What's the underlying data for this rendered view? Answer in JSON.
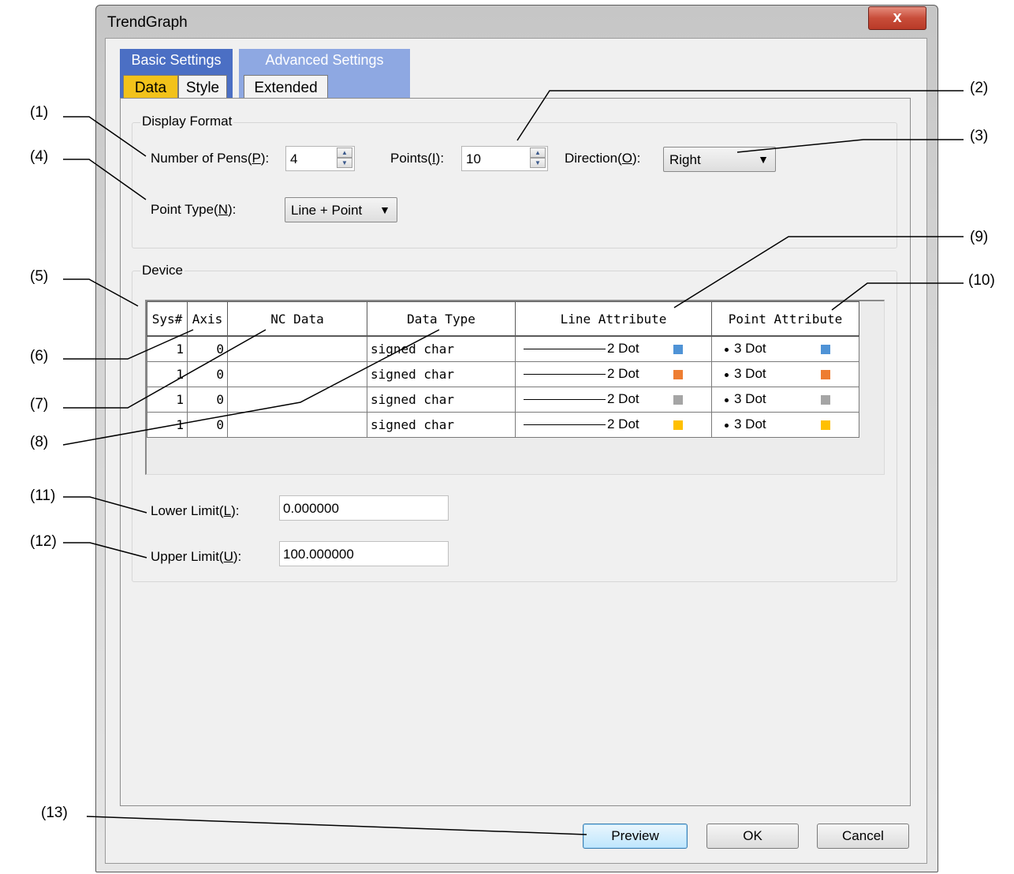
{
  "window": {
    "title": "TrendGraph",
    "close_glyph": "x"
  },
  "tabs": {
    "basic": {
      "title": "Basic Settings",
      "subtabs": [
        "Data",
        "Style"
      ]
    },
    "advanced": {
      "title": "Advanced Settings",
      "subtabs": [
        "Extended"
      ]
    },
    "active": "Data"
  },
  "display_format": {
    "group_label": "Display Format",
    "pens": {
      "label": "Number of Pens(",
      "mnemonic": "P",
      "suffix": "):",
      "value": "4"
    },
    "points": {
      "label": "Points(",
      "mnemonic": "I",
      "suffix": "):",
      "value": "10"
    },
    "direction": {
      "label": "Direction(",
      "mnemonic": "O",
      "suffix": "):",
      "value": "Right"
    },
    "point_type": {
      "label": "Point Type(",
      "mnemonic": "N",
      "suffix": "):",
      "value": "Line + Point"
    }
  },
  "device": {
    "group_label": "Device",
    "columns": [
      "Sys#",
      "Axis",
      "NC Data",
      "Data Type",
      "Line Attribute",
      "Point Attribute"
    ],
    "rows": [
      {
        "sys": "1",
        "axis": "0",
        "nc_data": "",
        "data_type": "signed char",
        "line_attr": "2 Dot",
        "line_color": "#4f93d6",
        "point_attr": "3 Dot",
        "point_color": "#4f93d6"
      },
      {
        "sys": "1",
        "axis": "0",
        "nc_data": "",
        "data_type": "signed char",
        "line_attr": "2 Dot",
        "line_color": "#ee7d31",
        "point_attr": "3 Dot",
        "point_color": "#ee7d31"
      },
      {
        "sys": "1",
        "axis": "0",
        "nc_data": "",
        "data_type": "signed char",
        "line_attr": "2 Dot",
        "line_color": "#a5a5a5",
        "point_attr": "3 Dot",
        "point_color": "#a5a5a5"
      },
      {
        "sys": "1",
        "axis": "0",
        "nc_data": "",
        "data_type": "signed char",
        "line_attr": "2 Dot",
        "line_color": "#ffc000",
        "point_attr": "3 Dot",
        "point_color": "#ffc000"
      }
    ],
    "lower_limit": {
      "label": "Lower Limit(",
      "mnemonic": "L",
      "suffix": "):",
      "value": "0.000000"
    },
    "upper_limit": {
      "label": "Upper Limit(",
      "mnemonic": "U",
      "suffix": "):",
      "value": "100.000000"
    }
  },
  "buttons": {
    "preview": "Preview",
    "ok": "OK",
    "cancel": "Cancel"
  },
  "callouts": [
    "(1)",
    "(2)",
    "(3)",
    "(4)",
    "(5)",
    "(6)",
    "(7)",
    "(8)",
    "(9)",
    "(10)",
    "(11)",
    "(12)",
    "(13)"
  ],
  "spin_icons": {
    "up": "spin-up-icon",
    "down": "spin-down-icon"
  },
  "colors": {
    "tab_basic": "#4b6fc4",
    "tab_advanced": "#8ea8e2",
    "tab_active": "#f2c21a",
    "close_button": "#c84d3a"
  }
}
